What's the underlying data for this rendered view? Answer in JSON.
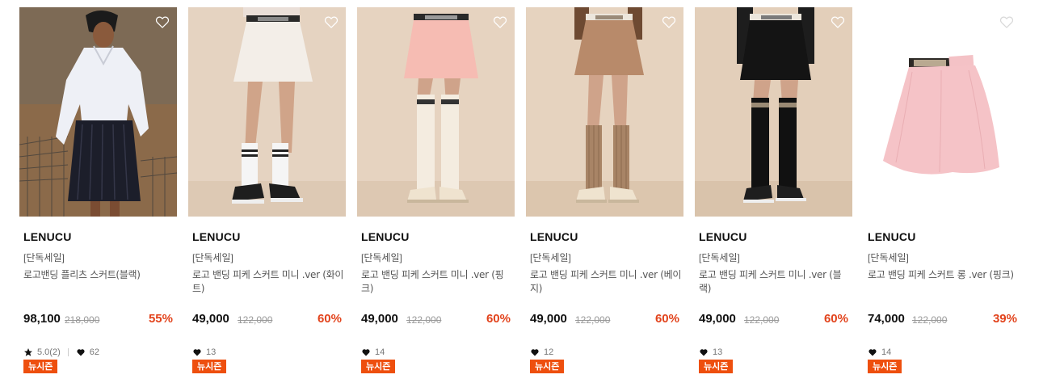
{
  "products": [
    {
      "brand": "LENUCU",
      "tag": "[단독세일]",
      "name": "로고밴딩 플리츠 스커트(블랙)",
      "price": "98,100",
      "original_price": "218,000",
      "discount": "55%",
      "rating": "5.0(2)",
      "likes": "62",
      "badge": "뉴시즌",
      "image": "model-black-pleated-skirt",
      "wishlist_icon": "heart-outline-icon"
    },
    {
      "brand": "LENUCU",
      "tag": "[단독세일]",
      "name": "로고 밴딩 피케 스커트 미니 .ver (화이트)",
      "price": "49,000",
      "original_price": "122,000",
      "discount": "60%",
      "rating": "",
      "likes": "13",
      "badge": "뉴시즌",
      "image": "model-white-mini-skirt",
      "wishlist_icon": "heart-outline-icon"
    },
    {
      "brand": "LENUCU",
      "tag": "[단독세일]",
      "name": "로고 밴딩 피케 스커트 미니 .ver (핑크)",
      "price": "49,000",
      "original_price": "122,000",
      "discount": "60%",
      "rating": "",
      "likes": "14",
      "badge": "뉴시즌",
      "image": "model-pink-mini-skirt",
      "wishlist_icon": "heart-outline-icon"
    },
    {
      "brand": "LENUCU",
      "tag": "[단독세일]",
      "name": "로고 밴딩 피케 스커트 미니 .ver (베이지)",
      "price": "49,000",
      "original_price": "122,000",
      "discount": "60%",
      "rating": "",
      "likes": "12",
      "badge": "뉴시즌",
      "image": "model-beige-mini-skirt",
      "wishlist_icon": "heart-outline-icon"
    },
    {
      "brand": "LENUCU",
      "tag": "[단독세일]",
      "name": "로고 밴딩 피케 스커트 미니 .ver (블랙)",
      "price": "49,000",
      "original_price": "122,000",
      "discount": "60%",
      "rating": "",
      "likes": "13",
      "badge": "뉴시즌",
      "image": "model-black-mini-skirt",
      "wishlist_icon": "heart-outline-icon"
    },
    {
      "brand": "LENUCU",
      "tag": "[단독세일]",
      "name": "로고 밴딩 피케 스커트 롱 .ver (핑크)",
      "price": "74,000",
      "original_price": "122,000",
      "discount": "39%",
      "rating": "",
      "likes": "14",
      "badge": "뉴시즌",
      "image": "product-pink-long-skirt",
      "wishlist_icon": "heart-outline-icon"
    }
  ],
  "colors": {
    "discount": "#e2431c",
    "badge": "#ee4f0e",
    "text": "#111111",
    "muted": "#555555",
    "strike": "#999999"
  }
}
